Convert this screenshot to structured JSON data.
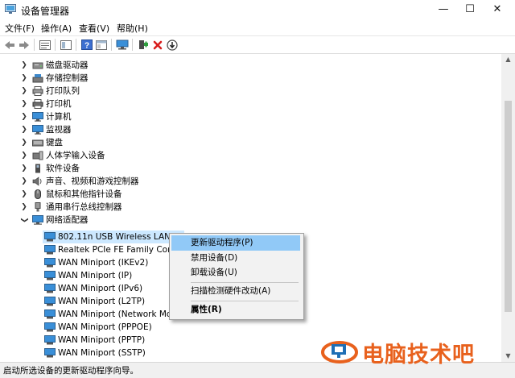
{
  "window": {
    "title": "设备管理器",
    "buttons": {
      "minimize": "—",
      "maximize": "☐",
      "close": "✕"
    }
  },
  "menu": [
    "文件(F)",
    "操作(A)",
    "查看(V)",
    "帮助(H)"
  ],
  "toolbar": [
    "back",
    "forward",
    "properties",
    "show-hide-pane",
    "help",
    "view",
    "scan-hardware",
    "add-driver",
    "uninstall",
    "update"
  ],
  "tree": [
    {
      "label": "磁盘驱动器",
      "icon": "disk-drive-icon",
      "expanded": false
    },
    {
      "label": "存储控制器",
      "icon": "storage-controller-icon",
      "expanded": false
    },
    {
      "label": "打印队列",
      "icon": "print-queue-icon",
      "expanded": false
    },
    {
      "label": "打印机",
      "icon": "printer-icon",
      "expanded": false
    },
    {
      "label": "计算机",
      "icon": "computer-icon",
      "expanded": false
    },
    {
      "label": "监视器",
      "icon": "monitor-icon",
      "expanded": false
    },
    {
      "label": "键盘",
      "icon": "keyboard-icon",
      "expanded": false
    },
    {
      "label": "人体学输入设备",
      "icon": "hid-icon",
      "expanded": false
    },
    {
      "label": "软件设备",
      "icon": "software-device-icon",
      "expanded": false
    },
    {
      "label": "声音、视频和游戏控制器",
      "icon": "sound-icon",
      "expanded": false
    },
    {
      "label": "鼠标和其他指针设备",
      "icon": "mouse-icon",
      "expanded": false
    },
    {
      "label": "通用串行总线控制器",
      "icon": "usb-icon",
      "expanded": false
    },
    {
      "label": "网络适配器",
      "icon": "network-adapter-icon",
      "expanded": true
    }
  ],
  "network_adapters": [
    "802.11n USB Wireless LAN Ca",
    "Realtek PCIe FE Family Contro",
    "WAN Miniport (IKEv2)",
    "WAN Miniport (IP)",
    "WAN Miniport (IPv6)",
    "WAN Miniport (L2TP)",
    "WAN Miniport (Network Mo",
    "WAN Miniport (PPPOE)",
    "WAN Miniport (PPTP)",
    "WAN Miniport (SSTP)"
  ],
  "context_menu": {
    "update": "更新驱动程序(P)",
    "disable": "禁用设备(D)",
    "uninstall": "卸载设备(U)",
    "scan": "扫描检测硬件改动(A)",
    "properties": "属性(R)"
  },
  "status": "启动所选设备的更新驱动程序向导。",
  "watermark": "电脑技术吧",
  "colors": {
    "selection": "#cce8ff",
    "menu_highlight": "#91c9f7",
    "watermark": "#e8611d"
  }
}
